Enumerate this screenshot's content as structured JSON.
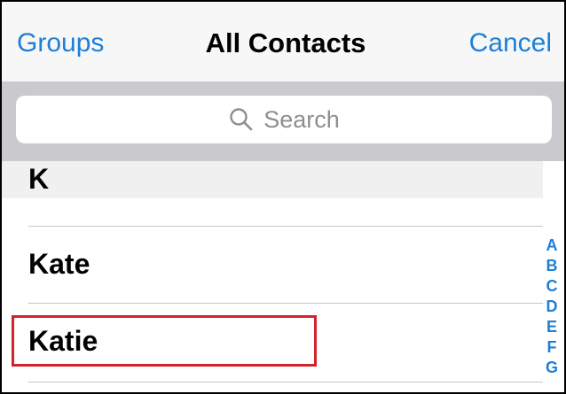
{
  "navbar": {
    "left_label": "Groups",
    "title": "All Contacts",
    "right_label": "Cancel"
  },
  "search": {
    "placeholder": "Search"
  },
  "section": {
    "letter": "K"
  },
  "contacts": [
    {
      "name": "Kate"
    },
    {
      "name": "Katie"
    }
  ],
  "index": [
    "A",
    "B",
    "C",
    "D",
    "E",
    "F",
    "G"
  ],
  "colors": {
    "accent": "#1f7fd6",
    "highlight": "#d2232a",
    "search_background": "#c9c9ce",
    "navbar_background": "#f7f7f8"
  },
  "icons": {
    "search": "search-icon"
  }
}
